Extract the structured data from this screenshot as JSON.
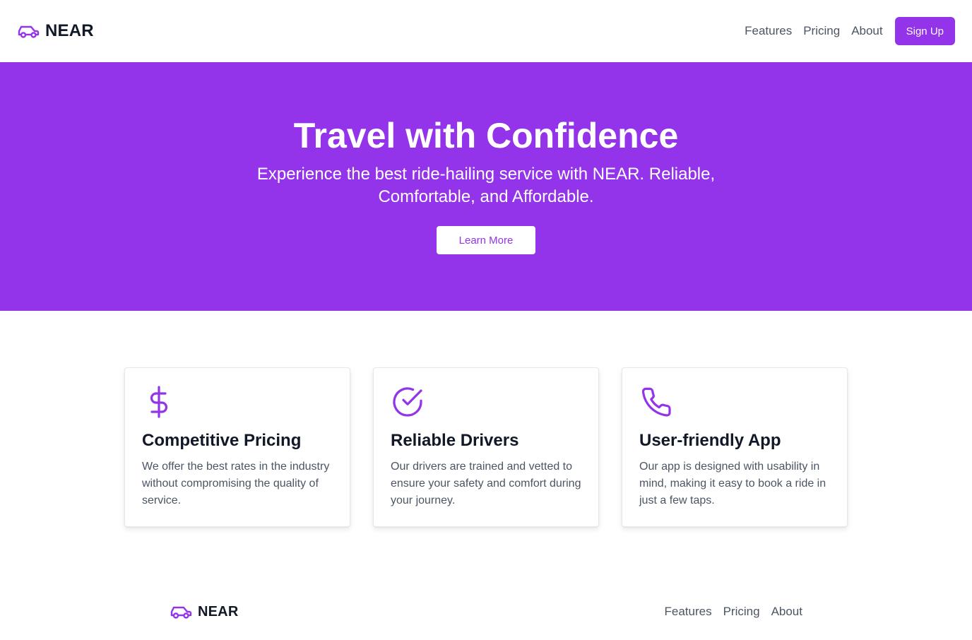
{
  "header": {
    "brand_name": "NEAR",
    "brand_icon": "car-icon",
    "nav": [
      "Features",
      "Pricing",
      "About"
    ],
    "signup_label": "Sign Up"
  },
  "hero": {
    "title": "Travel with Confidence",
    "subtitle": "Experience the best ride-hailing service with NEAR. Reliable, Comfortable, and Affordable.",
    "cta_label": "Learn More"
  },
  "features": [
    {
      "icon": "dollar-icon",
      "title": "Competitive Pricing",
      "text": "We offer the best rates in the industry without compromising the quality of service."
    },
    {
      "icon": "check-circle-icon",
      "title": "Reliable Drivers",
      "text": "Our drivers are trained and vetted to ensure your safety and comfort during your journey."
    },
    {
      "icon": "phone-icon",
      "title": "User-friendly App",
      "text": "Our app is designed with usability in mind, making it easy to book a ride in just a few taps."
    }
  ],
  "footer": {
    "brand_name": "NEAR",
    "nav": [
      "Features",
      "Pricing",
      "About"
    ]
  },
  "colors": {
    "accent": "#9333ea",
    "text_dark": "#111827",
    "text_muted": "#4b5563"
  }
}
